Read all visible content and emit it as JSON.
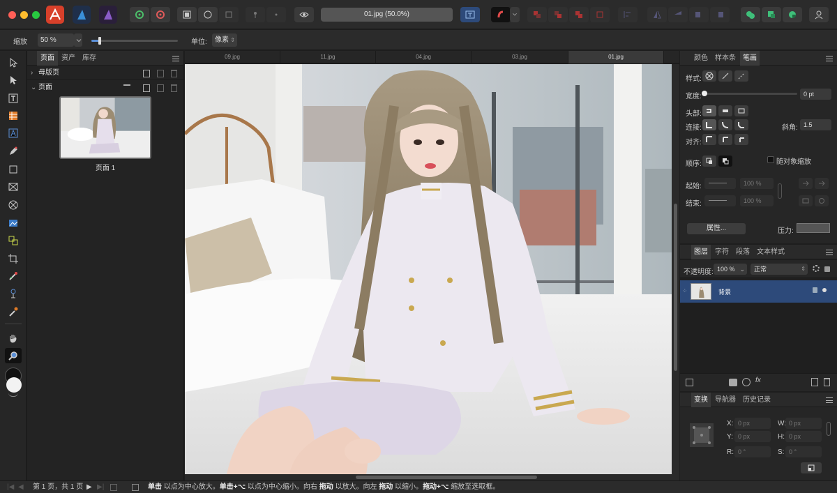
{
  "window": {
    "doc_title": "01.jpg (50.0%)"
  },
  "context_toolbar": {
    "zoom_label": "缩放",
    "zoom_value": "50 %",
    "zoom_slider": 0.1,
    "unit_label": "单位:",
    "unit_value": "像素"
  },
  "pages_panel": {
    "tabs": [
      "页面",
      "资产",
      "库存"
    ],
    "master_pages_label": "母版页",
    "pages_label": "页面",
    "page_thumb_label": "页面 1"
  },
  "doc_tabs": [
    "09.jpg",
    "11.jpg",
    "04.jpg",
    "03.jpg",
    "01.jpg"
  ],
  "stroke_panel": {
    "tabs": [
      "颜色",
      "样本条",
      "笔画"
    ],
    "style_label": "样式:",
    "width_label": "宽度:",
    "width_value": "0 pt",
    "cap_label": "头部:",
    "join_label": "连接:",
    "miter_label": "斜角:",
    "miter_value": "1.5",
    "align_label": "对齐:",
    "order_label": "顺序:",
    "scale_with_object_label": "随对象缩放",
    "start_label": "起始:",
    "start_pct": "100 %",
    "end_label": "结束:",
    "end_pct": "100 %",
    "properties_button": "属性...",
    "pressure_label": "压力:"
  },
  "layers_panel": {
    "tabs": [
      "图层",
      "字符",
      "段落",
      "文本样式"
    ],
    "opacity_label": "不透明度:",
    "opacity_value": "100 %",
    "blend_mode": "正常",
    "layer_name": "背景"
  },
  "transform_panel": {
    "tabs": [
      "变换",
      "导航器",
      "历史记录"
    ],
    "x_label": "X:",
    "x_value": "0 px",
    "y_label": "Y:",
    "y_value": "0 px",
    "w_label": "W:",
    "w_value": "0 px",
    "h_label": "H:",
    "h_value": "0 px",
    "r_label": "R:",
    "r_value": "0 °",
    "s_label": "S:",
    "s_value": "0 °"
  },
  "statusbar": {
    "page_info": "第 1 页，共 1 页",
    "hint_parts": [
      "单击",
      " 以点为中心放大。",
      "单击+⌥",
      " 以点为中心缩小。向右 ",
      "拖动",
      " 以放大。向左 ",
      "拖动",
      " 以缩小。",
      "拖动+⌥",
      " 缩放至选取框。"
    ]
  },
  "colors": {
    "accent_blue": "#2d4a7a",
    "photo_persona": "#d8402a",
    "designer_persona": "#2b6cb0",
    "publisher_persona": "#6d3fa0"
  }
}
